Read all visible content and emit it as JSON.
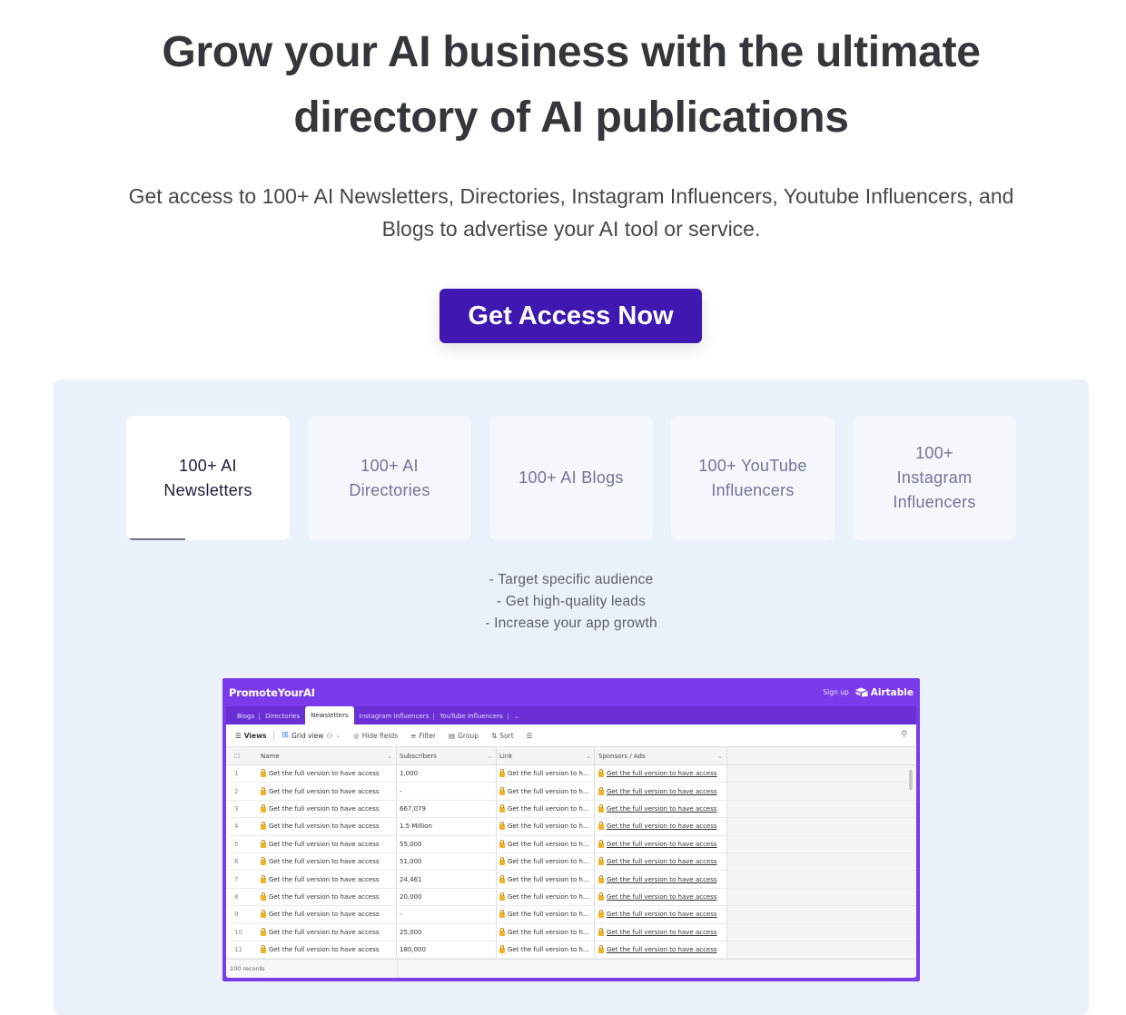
{
  "hero": {
    "title_line1": "Grow your AI business with the ultimate",
    "title_line2": "directory of AI publications",
    "subtitle_line1": "Get access to 100+ AI Newsletters, Directories, Instagram Influencers, Youtube Influencers, and",
    "subtitle_line2": "Blogs to advertise your AI tool or service.",
    "cta_label": "Get Access Now"
  },
  "category_tabs": [
    {
      "line1": "100+ AI",
      "line2": "Newsletters",
      "line3": "",
      "active": true,
      "progress": 0.36
    },
    {
      "line1": "100+ AI",
      "line2": "Directories",
      "line3": "",
      "active": false
    },
    {
      "line1": "100+ AI Blogs",
      "line2": "",
      "line3": "",
      "active": false
    },
    {
      "line1": "100+ YouTube",
      "line2": "Influencers",
      "line3": "",
      "active": false
    },
    {
      "line1": "100+",
      "line2": "Instagram",
      "line3": "Influencers",
      "active": false
    }
  ],
  "benefits": [
    "- Target specific audience",
    "- Get high-quality leads",
    "- Increase your app growth"
  ],
  "embed": {
    "brand": "PromoteYourAI",
    "signup": "Sign up",
    "airtable": "Airtable",
    "tabs": [
      "Blogs",
      "Directories",
      "Newsletters",
      "Instagram Influencers",
      "YouTube Influencers"
    ],
    "active_tab": "Newsletters",
    "toolbar": {
      "views": "Views",
      "grid_view": "Grid view",
      "hide_fields": "Hide fields",
      "filter": "Filter",
      "group": "Group",
      "sort": "Sort"
    },
    "columns": [
      "Name",
      "Subscribers",
      "Link",
      "Sponsors / Ads"
    ],
    "locked_text": "Get the full version to have access",
    "locked_text_truncated": "Get the full version to h...",
    "rows": [
      {
        "n": "1",
        "subscribers": "1,000"
      },
      {
        "n": "2",
        "subscribers": "-"
      },
      {
        "n": "3",
        "subscribers": "667,079"
      },
      {
        "n": "4",
        "subscribers": "1.5 Million"
      },
      {
        "n": "5",
        "subscribers": "55,000"
      },
      {
        "n": "6",
        "subscribers": "51,000"
      },
      {
        "n": "7",
        "subscribers": "24,461"
      },
      {
        "n": "8",
        "subscribers": "20,000"
      },
      {
        "n": "9",
        "subscribers": "-"
      },
      {
        "n": "10",
        "subscribers": "25,000"
      },
      {
        "n": "11",
        "subscribers": "180,000"
      }
    ],
    "record_count": "100 records"
  },
  "colors": {
    "cta": "#3e18b0",
    "embed_purple": "#7b3bea",
    "panel_bg": "#ebf1fa"
  }
}
